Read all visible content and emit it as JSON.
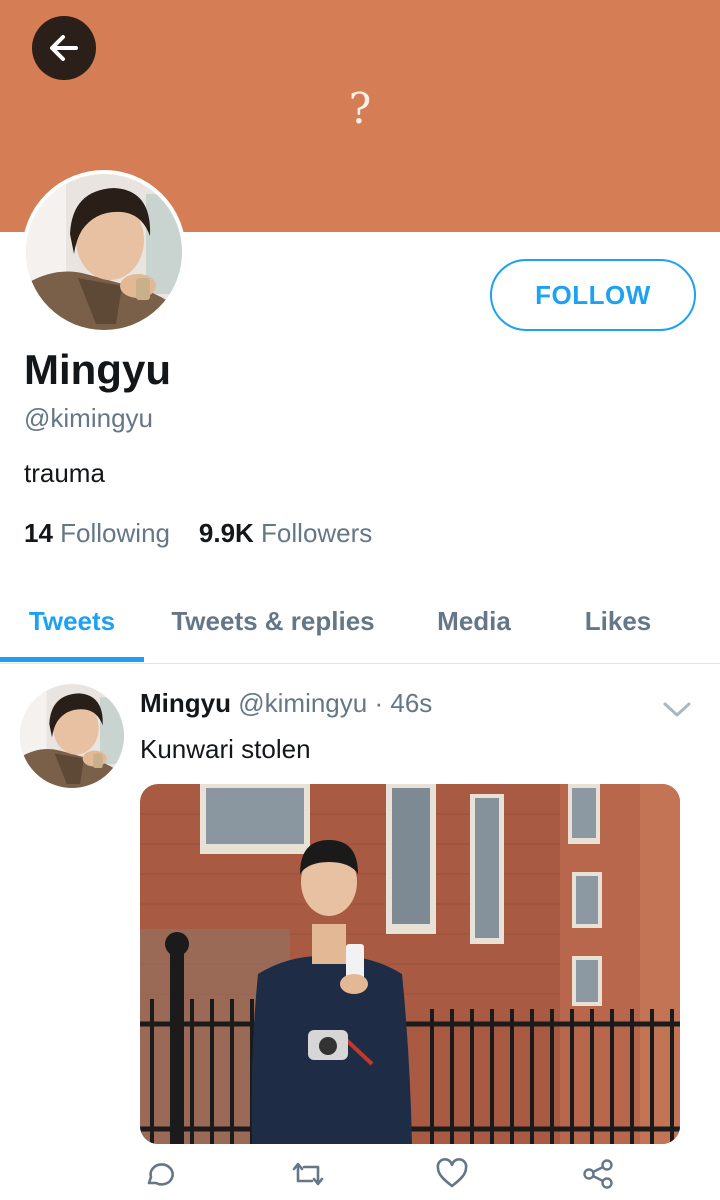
{
  "header": {
    "back_icon": "arrow-left-icon",
    "banner_glyph": "?",
    "banner_color": "#d57e55"
  },
  "profile": {
    "follow_label": "FOLLOW",
    "name": "Mingyu",
    "handle": "@kimingyu",
    "bio": "trauma",
    "following_count": "14",
    "following_label": "Following",
    "followers_count": "9.9K",
    "followers_label": "Followers"
  },
  "tabs": [
    {
      "label": "Tweets",
      "active": true
    },
    {
      "label": "Tweets & replies",
      "active": false
    },
    {
      "label": "Media",
      "active": false
    },
    {
      "label": "Likes",
      "active": false
    }
  ],
  "tweet": {
    "author_name": "Mingyu",
    "author_handle": "@kimingyu",
    "separator": "·",
    "time": "46s",
    "text": "Kunwari stolen",
    "menu_icon": "chevron-down-icon",
    "actions": [
      "reply-icon",
      "retweet-icon",
      "like-icon",
      "share-icon"
    ]
  },
  "colors": {
    "accent": "#1da1f2",
    "secondary_text": "#657786",
    "primary_text": "#14171a"
  }
}
